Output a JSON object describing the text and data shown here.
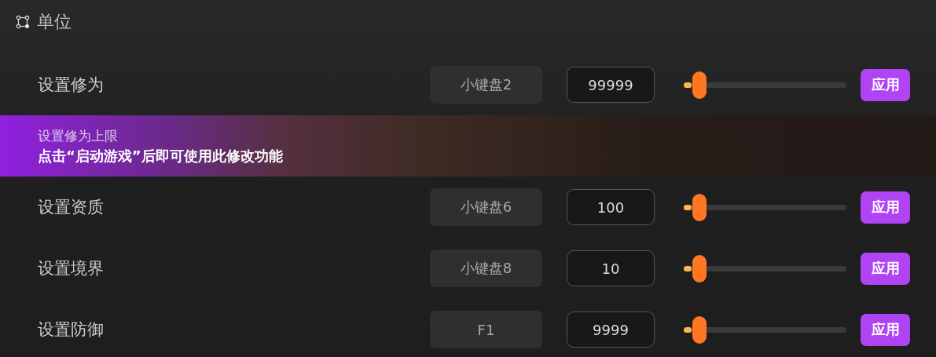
{
  "section": {
    "title": "单位"
  },
  "rows": [
    {
      "label": "设置修为",
      "hotkey": "小键盘2",
      "value": "99999",
      "level": 0.05,
      "button": "应用",
      "tooltip": {
        "title": "设置修为上限",
        "message": "点击“启动游戏”后即可使用此修改功能"
      }
    },
    {
      "label": "设置资质",
      "hotkey": "小键盘6",
      "value": "100",
      "level": 0.05,
      "button": "应用"
    },
    {
      "label": "设置境界",
      "hotkey": "小键盘8",
      "value": "10",
      "level": 0.05,
      "button": "应用"
    },
    {
      "label": "设置防御",
      "hotkey": "F1",
      "value": "9999",
      "level": 0.05,
      "button": "应用"
    }
  ]
}
